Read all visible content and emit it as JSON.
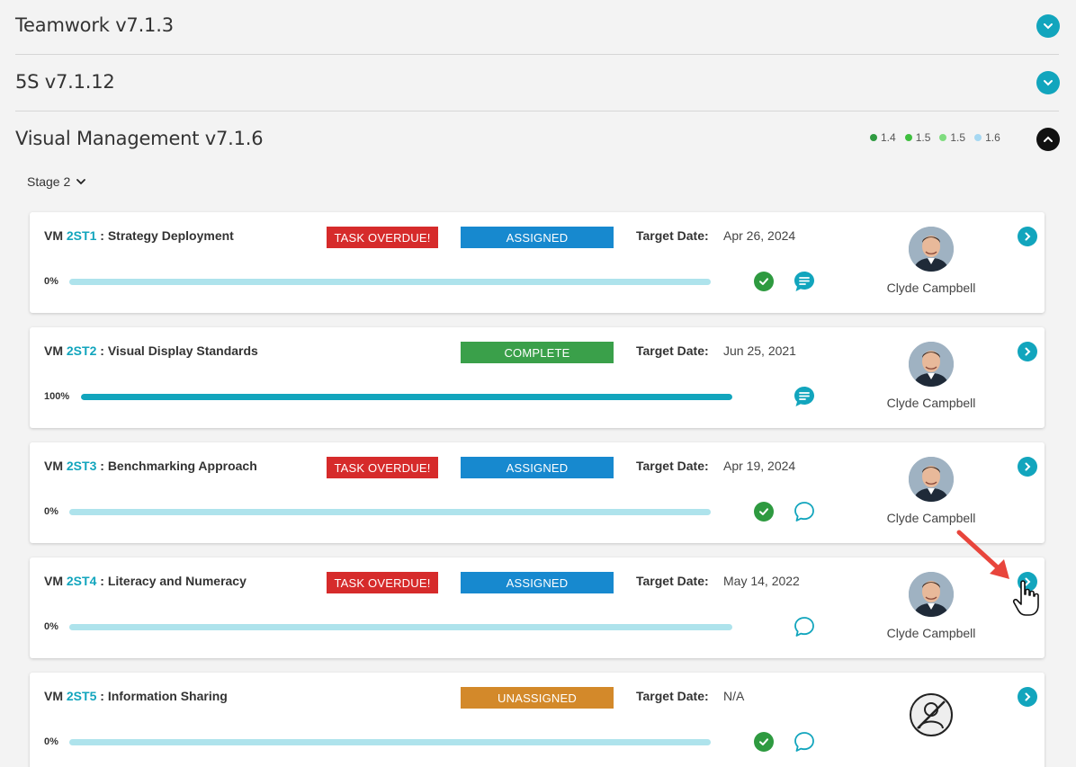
{
  "sections": [
    {
      "title": "Teamwork v7.1.3",
      "expanded": false
    },
    {
      "title": "5S v7.1.12",
      "expanded": false
    },
    {
      "title": "Visual Management v7.1.6",
      "expanded": true
    }
  ],
  "legend": [
    {
      "label": "1.4",
      "color": "#2e9a40"
    },
    {
      "label": "1.5",
      "color": "#3fbf3f"
    },
    {
      "label": "1.5",
      "color": "#7fdc7f"
    },
    {
      "label": "1.6",
      "color": "#a6d8f2"
    }
  ],
  "stage_filter": {
    "label": "Stage 2"
  },
  "task_common": {
    "prefix": "VM",
    "separator": ":",
    "target_label": "Target Date:"
  },
  "tasks": [
    {
      "code": "2ST1",
      "name": "Strategy Deployment",
      "overdue_label": "TASK OVERDUE!",
      "status": "ASSIGNED",
      "status_color": "#1789cf",
      "target_date": "Apr 26, 2024",
      "progress_label": "0%",
      "progress": 0,
      "has_check": true,
      "comment_filled": true,
      "assignee": "Clyde Campbell"
    },
    {
      "code": "2ST2",
      "name": "Visual Display Standards",
      "overdue_label": "",
      "status": "COMPLETE",
      "status_color": "#3aa04a",
      "target_date": "Jun 25, 2021",
      "progress_label": "100%",
      "progress": 100,
      "has_check": false,
      "comment_filled": true,
      "assignee": "Clyde Campbell"
    },
    {
      "code": "2ST3",
      "name": "Benchmarking Approach",
      "overdue_label": "TASK OVERDUE!",
      "status": "ASSIGNED",
      "status_color": "#1789cf",
      "target_date": "Apr 19, 2024",
      "progress_label": "0%",
      "progress": 0,
      "has_check": true,
      "comment_filled": false,
      "assignee": "Clyde Campbell"
    },
    {
      "code": "2ST4",
      "name": "Literacy and Numeracy",
      "overdue_label": "TASK OVERDUE!",
      "status": "ASSIGNED",
      "status_color": "#1789cf",
      "target_date": "May 14, 2022",
      "progress_label": "0%",
      "progress": 0,
      "has_check": false,
      "comment_filled": false,
      "assignee": "Clyde Campbell"
    },
    {
      "code": "2ST5",
      "name": "Information Sharing",
      "overdue_label": "",
      "status": "UNASSIGNED",
      "status_color": "#d3892a",
      "target_date": "N/A",
      "progress_label": "0%",
      "progress": 0,
      "has_check": true,
      "comment_filled": false,
      "assignee": ""
    }
  ],
  "colors": {
    "accent": "#12a5bd",
    "overdue": "#d62b2b",
    "check": "#2e9a40",
    "annotation": "#e8453c"
  }
}
